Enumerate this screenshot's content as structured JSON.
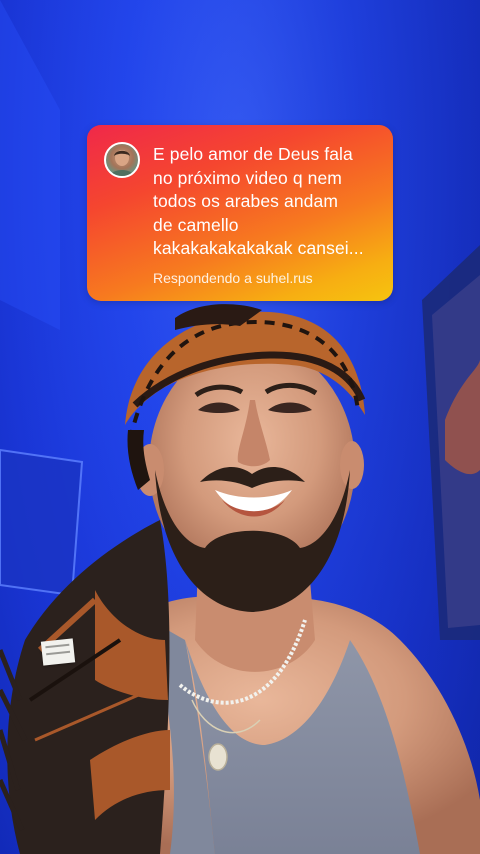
{
  "comment_sticker": {
    "avatar_icon": "user-avatar-photo",
    "text": "E pelo amor de Deus fala\nno próximo video q nem\ntodos os arabes andam\nde camello\nkakakakakakakak cansei...",
    "reply_prefix": "Respondendo a",
    "reply_username": "suhel.rus",
    "colors": {
      "gradient_start": "#f0284a",
      "gradient_end": "#f6c40f",
      "text": "#ffffff"
    }
  },
  "scene": {
    "background_color": "#1f3fe6"
  }
}
